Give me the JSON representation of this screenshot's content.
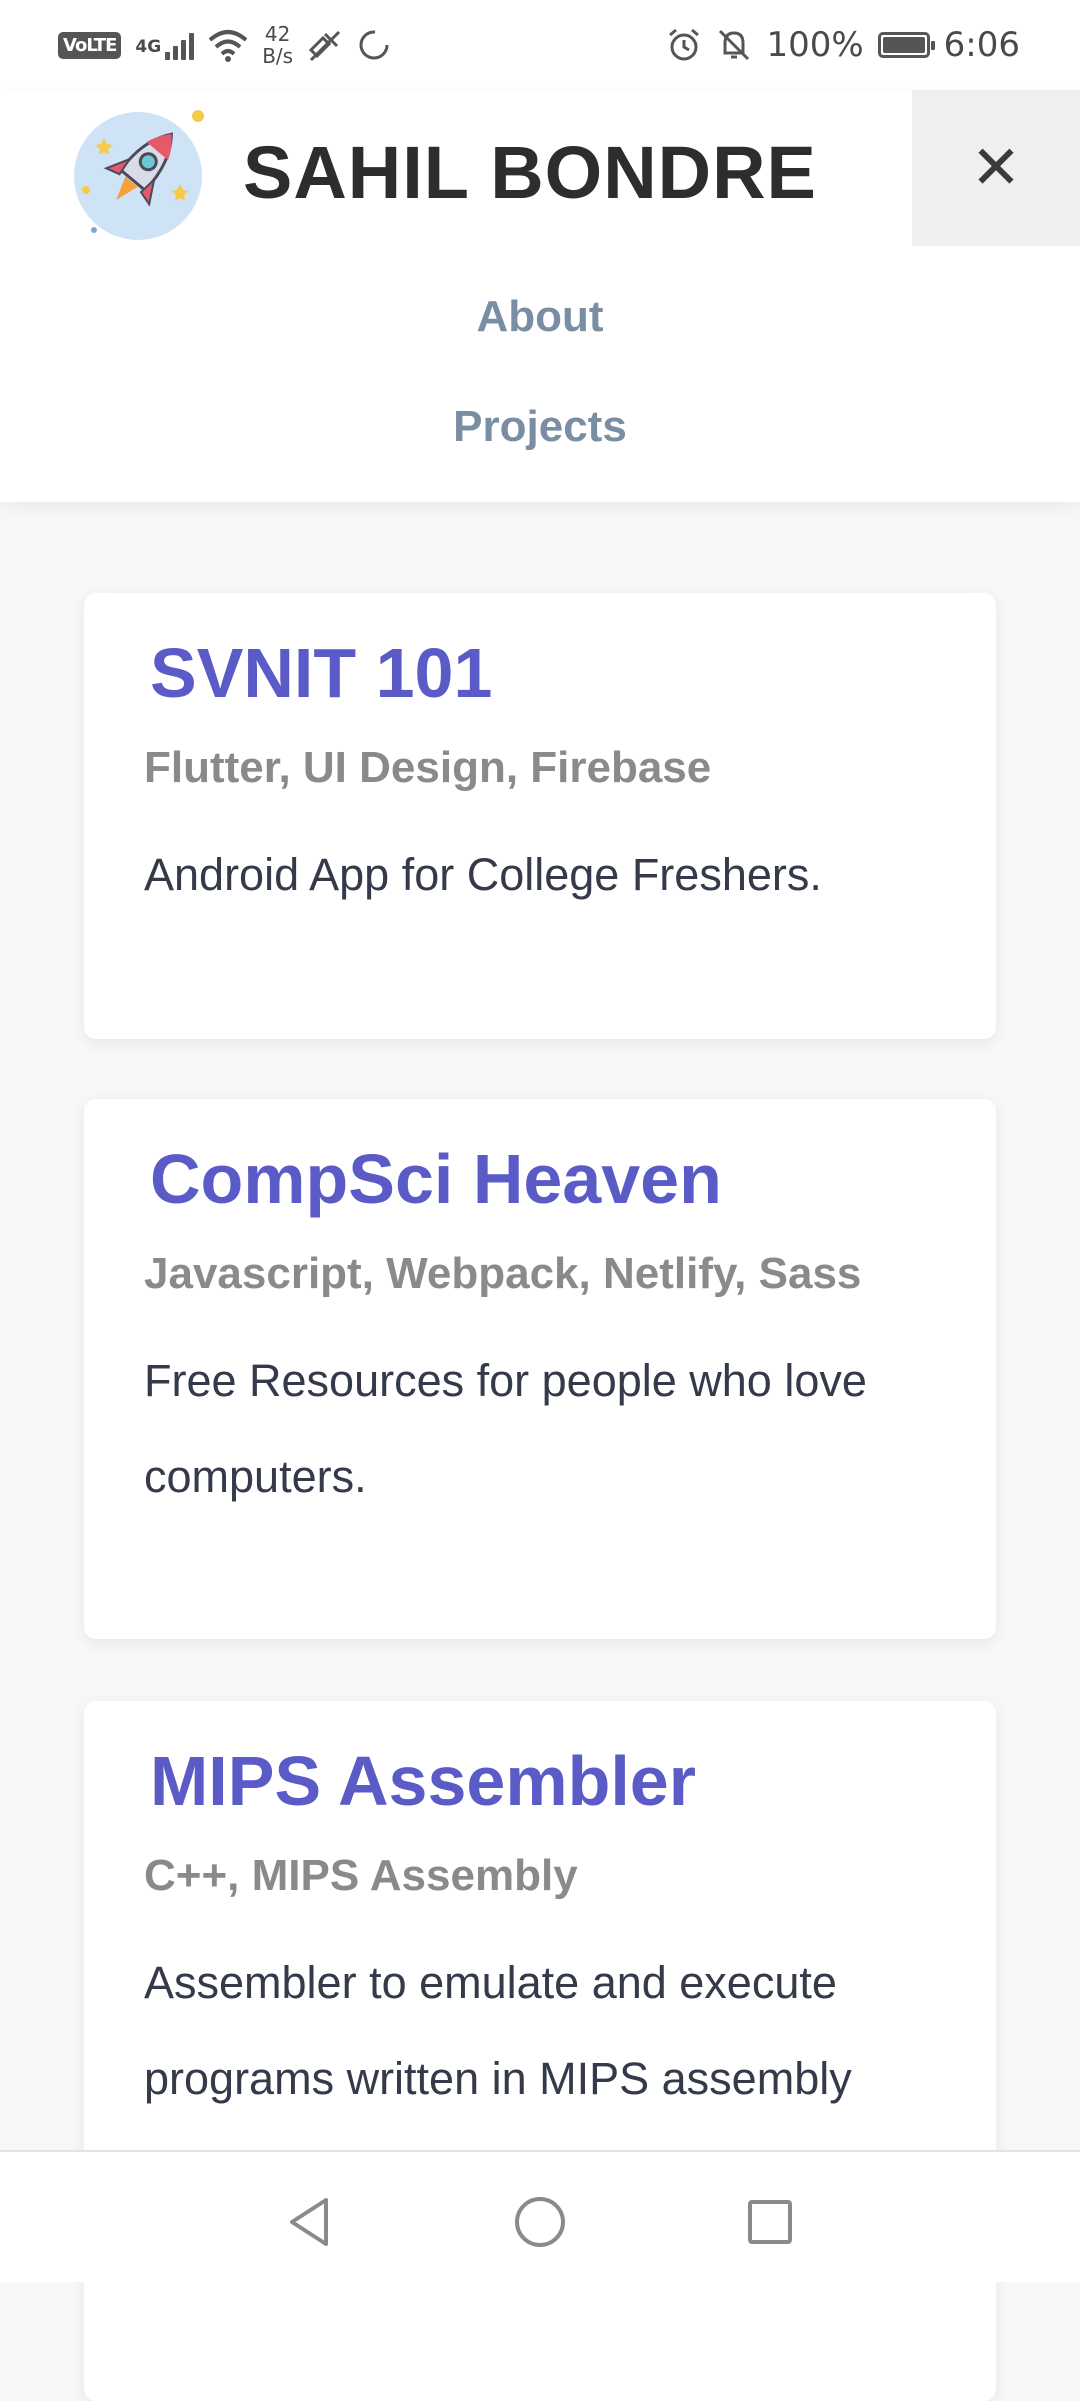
{
  "status_bar": {
    "volte": "VoLTE",
    "network": "4G",
    "speed_value": "42",
    "speed_unit": "B/s",
    "battery_percent": "100%",
    "time": "6:06"
  },
  "header": {
    "title": "SAHIL BONDRE",
    "close_symbol": "✕",
    "nav": [
      {
        "label": "About"
      },
      {
        "label": "Projects"
      }
    ]
  },
  "projects": [
    {
      "title": "SVNIT 101",
      "tags": "Flutter, UI Design, Firebase",
      "description": "Android App for College Freshers."
    },
    {
      "title": "CompSci Heaven",
      "tags": "Javascript, Webpack, Netlify, Sass",
      "description": "Free Resources for people who love computers."
    },
    {
      "title": "MIPS Assembler",
      "tags": "C++, MIPS Assembly",
      "description": "Assembler to emulate and execute programs written in MIPS assembly"
    }
  ],
  "icons": {
    "logo": "rocket-logo-icon",
    "close": "close-icon",
    "back": "back-triangle-icon",
    "home": "home-circle-icon",
    "recents": "recents-square-icon"
  },
  "colors": {
    "accent": "#5b5bc7",
    "nav_link": "#7a8ea3",
    "tags": "#8a8a8a",
    "title": "#2d2d2d"
  }
}
